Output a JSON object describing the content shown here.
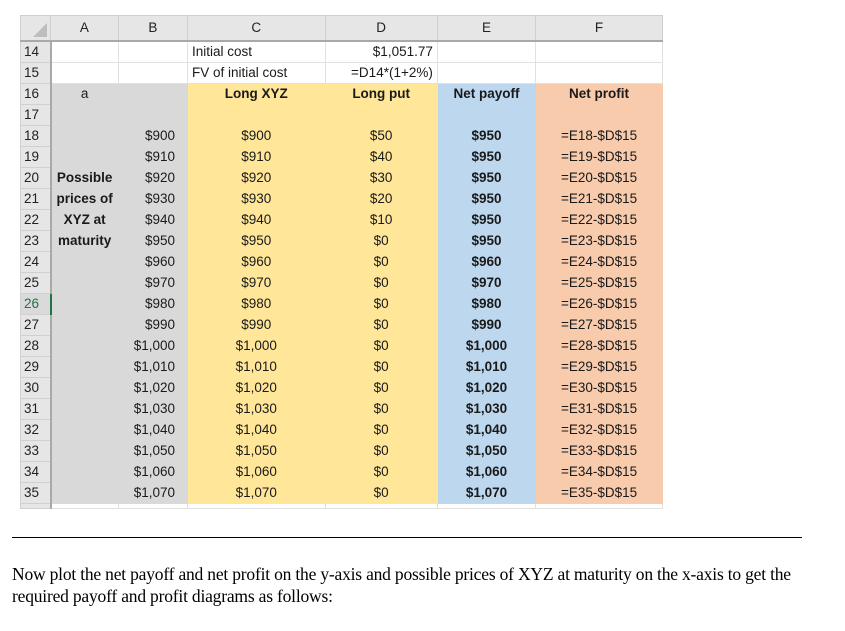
{
  "spreadsheet": {
    "column_headers": [
      "A",
      "B",
      "C",
      "D",
      "E",
      "F"
    ],
    "info_rows": [
      {
        "row": "14",
        "label": "Initial cost",
        "value": "$1,051.77"
      },
      {
        "row": "15",
        "label": "FV of initial cost",
        "value": "=D14*(1+2%)"
      }
    ],
    "header_row": {
      "row": "16",
      "a_label": "a",
      "long_xyz": "Long XYZ",
      "long_put": "Long put",
      "net_payoff": "Net payoff",
      "net_profit": "Net profit"
    },
    "blank_row": "17",
    "side_label_lines": [
      "Possible",
      "prices of",
      "XYZ at",
      "maturity"
    ],
    "active_row": "26",
    "rows": [
      {
        "row": "18",
        "price": "$900",
        "long_xyz": "$900",
        "long_put": "$50",
        "net_payoff": "$950",
        "net_profit": "=E18-$D$15"
      },
      {
        "row": "19",
        "price": "$910",
        "long_xyz": "$910",
        "long_put": "$40",
        "net_payoff": "$950",
        "net_profit": "=E19-$D$15"
      },
      {
        "row": "20",
        "price": "$920",
        "long_xyz": "$920",
        "long_put": "$30",
        "net_payoff": "$950",
        "net_profit": "=E20-$D$15"
      },
      {
        "row": "21",
        "price": "$930",
        "long_xyz": "$930",
        "long_put": "$20",
        "net_payoff": "$950",
        "net_profit": "=E21-$D$15"
      },
      {
        "row": "22",
        "price": "$940",
        "long_xyz": "$940",
        "long_put": "$10",
        "net_payoff": "$950",
        "net_profit": "=E22-$D$15"
      },
      {
        "row": "23",
        "price": "$950",
        "long_xyz": "$950",
        "long_put": "$0",
        "net_payoff": "$950",
        "net_profit": "=E23-$D$15"
      },
      {
        "row": "24",
        "price": "$960",
        "long_xyz": "$960",
        "long_put": "$0",
        "net_payoff": "$960",
        "net_profit": "=E24-$D$15"
      },
      {
        "row": "25",
        "price": "$970",
        "long_xyz": "$970",
        "long_put": "$0",
        "net_payoff": "$970",
        "net_profit": "=E25-$D$15"
      },
      {
        "row": "26",
        "price": "$980",
        "long_xyz": "$980",
        "long_put": "$0",
        "net_payoff": "$980",
        "net_profit": "=E26-$D$15"
      },
      {
        "row": "27",
        "price": "$990",
        "long_xyz": "$990",
        "long_put": "$0",
        "net_payoff": "$990",
        "net_profit": "=E27-$D$15"
      },
      {
        "row": "28",
        "price": "$1,000",
        "long_xyz": "$1,000",
        "long_put": "$0",
        "net_payoff": "$1,000",
        "net_profit": "=E28-$D$15"
      },
      {
        "row": "29",
        "price": "$1,010",
        "long_xyz": "$1,010",
        "long_put": "$0",
        "net_payoff": "$1,010",
        "net_profit": "=E29-$D$15"
      },
      {
        "row": "30",
        "price": "$1,020",
        "long_xyz": "$1,020",
        "long_put": "$0",
        "net_payoff": "$1,020",
        "net_profit": "=E30-$D$15"
      },
      {
        "row": "31",
        "price": "$1,030",
        "long_xyz": "$1,030",
        "long_put": "$0",
        "net_payoff": "$1,030",
        "net_profit": "=E31-$D$15"
      },
      {
        "row": "32",
        "price": "$1,040",
        "long_xyz": "$1,040",
        "long_put": "$0",
        "net_payoff": "$1,040",
        "net_profit": "=E32-$D$15"
      },
      {
        "row": "33",
        "price": "$1,050",
        "long_xyz": "$1,050",
        "long_put": "$0",
        "net_payoff": "$1,050",
        "net_profit": "=E33-$D$15"
      },
      {
        "row": "34",
        "price": "$1,060",
        "long_xyz": "$1,060",
        "long_put": "$0",
        "net_payoff": "$1,060",
        "net_profit": "=E34-$D$15"
      },
      {
        "row": "35",
        "price": "$1,070",
        "long_xyz": "$1,070",
        "long_put": "$0",
        "net_payoff": "$1,070",
        "net_profit": "=E35-$D$15"
      }
    ],
    "colors": {
      "gray": "#d9d9d9",
      "yellow": "#ffe699",
      "blue": "#bdd7ee",
      "orange": "#f8cbad",
      "active_row": "#217346"
    }
  },
  "explanation": "Now plot the net payoff and net profit on the y-axis and possible prices of XYZ at maturity on the x-axis to get the required payoff and profit diagrams as follows:"
}
